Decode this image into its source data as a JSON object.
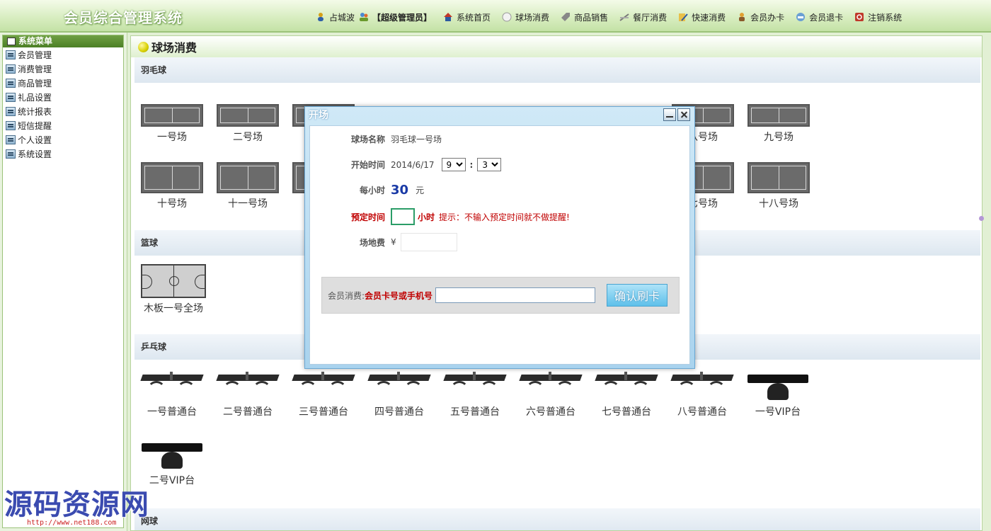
{
  "header": {
    "app_title": "会员综合管理系统",
    "user": "占城波",
    "role": "【超级管理员】",
    "nav": [
      "系统首页",
      "球场消费",
      "商品销售",
      "餐厅消费",
      "快速消费",
      "会员办卡",
      "会员退卡",
      "注销系统"
    ]
  },
  "sidebar": {
    "title": "系统菜单",
    "items": [
      "会员管理",
      "消费管理",
      "商品管理",
      "礼品设置",
      "统计报表",
      "短信提醒",
      "个人设置",
      "系统设置"
    ]
  },
  "main": {
    "title": "球场消费",
    "sections": {
      "badminton": "羽毛球",
      "basketball": "篮球",
      "pingpong": "乒乓球",
      "tennis": "网球"
    },
    "badminton_courts": [
      "一号场",
      "二号场",
      "八号场",
      "九号场",
      "十号场",
      "十一号场",
      "七号场",
      "十八号场"
    ],
    "basketball_courts": [
      "木板一号全场"
    ],
    "pingpong_tables": [
      "一号普通台",
      "二号普通台",
      "三号普通台",
      "四号普通台",
      "五号普通台",
      "六号普通台",
      "七号普通台",
      "八号普通台",
      "一号VIP台",
      "二号VIP台"
    ]
  },
  "modal": {
    "title": "开场",
    "court_name_label": "球场名称",
    "court_name": "羽毛球一号场",
    "start_label": "开始时间",
    "start_date": "2014/6/17",
    "hour": "9",
    "colon": ":",
    "minute": "3",
    "rate_label": "每小时",
    "rate": "30",
    "rate_unit": "元",
    "booking_label": "预定时间",
    "hours_unit": "小时",
    "hint": "提示：不输入预定时间就不做提醒!",
    "fee_label": "场地费",
    "fee_currency": "¥",
    "member_label": "会员消费:",
    "member_hint": "会员卡号或手机号",
    "member_value": "",
    "confirm": "确认刷卡"
  },
  "watermark": {
    "text": "源码资源网",
    "url": "http://www.net188.com"
  }
}
